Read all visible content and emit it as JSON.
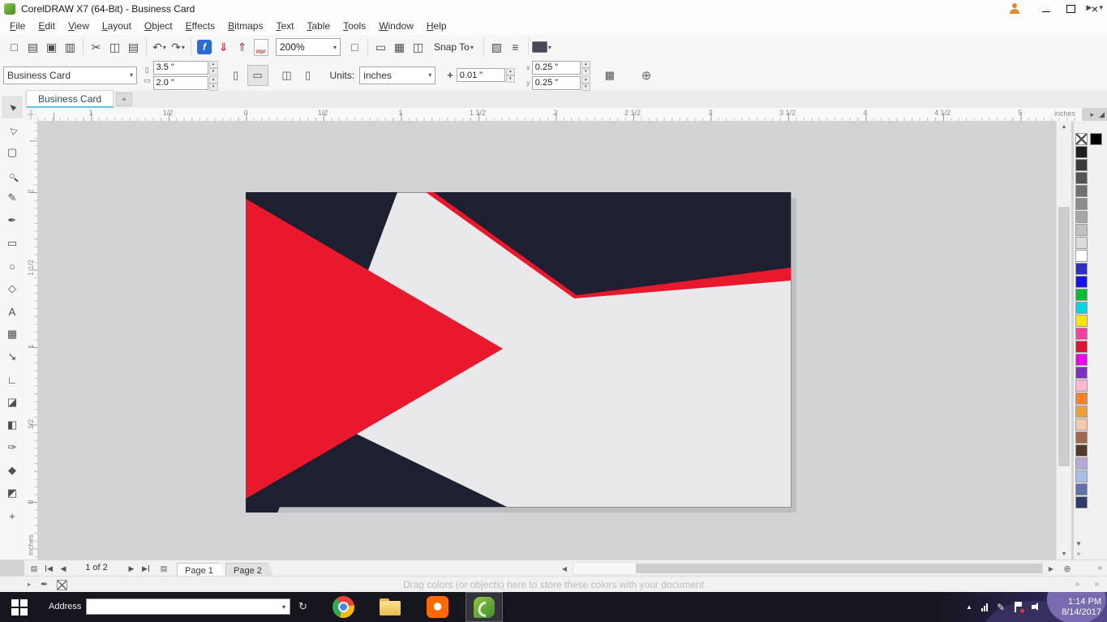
{
  "titlebar": {
    "title": "CorelDRAW X7 (64-Bit) - Business Card"
  },
  "menu": {
    "items": [
      "File",
      "Edit",
      "View",
      "Layout",
      "Object",
      "Effects",
      "Bitmaps",
      "Text",
      "Table",
      "Tools",
      "Window",
      "Help"
    ]
  },
  "toolbar": {
    "zoom_level": "200%",
    "snap_label": "Snap To",
    "pdf_label": "PDF",
    "f_label": "f"
  },
  "propbar": {
    "preset": "Business Card",
    "page_width": "3.5 \"",
    "page_height": "2.0 \"",
    "units_label": "Units:",
    "units": "inches",
    "nudge": "0.01 \"",
    "dup_x": "0.25 \"",
    "dup_y": "0.25 \""
  },
  "doctabs": {
    "active_tab": "Business Card",
    "add_tab": "+"
  },
  "rulers": {
    "h_labels": [
      "1",
      "1/2",
      "0",
      "1/2",
      "1",
      "1 1/2",
      "2",
      "2 1/2",
      "3",
      "3 1/2",
      "4",
      "4 1/2",
      "5"
    ],
    "v_labels": [
      "2",
      "1 1/2",
      "1",
      "1/2",
      "0"
    ],
    "h_unit": "inches",
    "v_unit": "inches"
  },
  "toolbox": [
    {
      "name": "Pick",
      "glyph": "▲"
    },
    {
      "name": "Shape",
      "glyph": "△"
    },
    {
      "name": "Crop",
      "glyph": "▢"
    },
    {
      "name": "Zoom",
      "glyph": "○"
    },
    {
      "name": "Freehand",
      "glyph": "✎"
    },
    {
      "name": "Artistic Media",
      "glyph": "✒"
    },
    {
      "name": "Rectangle",
      "glyph": "▭"
    },
    {
      "name": "Ellipse",
      "glyph": "○"
    },
    {
      "name": "Polygon",
      "glyph": "◇"
    },
    {
      "name": "Text",
      "glyph": "A"
    },
    {
      "name": "Table",
      "glyph": "▦"
    },
    {
      "name": "Parallel Dimension",
      "glyph": "↘"
    },
    {
      "name": "Connector",
      "glyph": "∟"
    },
    {
      "name": "Drop Shadow",
      "glyph": "◪"
    },
    {
      "name": "Transparency",
      "glyph": "◧"
    },
    {
      "name": "Color Eyedropper",
      "glyph": "✑"
    },
    {
      "name": "Interactive Fill",
      "glyph": "◆"
    },
    {
      "name": "Smart Fill",
      "glyph": "◩"
    },
    {
      "name": "Add Tools",
      "glyph": "+"
    }
  ],
  "canvas": {
    "card": {
      "bg": "#e9e9eb",
      "dark": "#1c2030",
      "red": "#e8192c",
      "shadow": "#bdbec0"
    }
  },
  "palette": {
    "black": "#000000",
    "colors": [
      "#1f1f1f",
      "#3a3a3a",
      "#555555",
      "#707070",
      "#8b8b8b",
      "#a6a6a6",
      "#c1c1c1",
      "#dcdcdc",
      "#ffffff",
      "#2e2ec8",
      "#1414f0",
      "#00c030",
      "#00d8e8",
      "#ffe400",
      "#ff3ca0",
      "#e81030",
      "#f000f0",
      "#8030c0",
      "#ffb8d0",
      "#ff8020",
      "#f0a030",
      "#f8c8a8",
      "#a06848",
      "#583828",
      "#b8a8d8",
      "#a8c0e8",
      "#6070a8",
      "#303c68"
    ]
  },
  "pagenav": {
    "counter": "1 of 2",
    "tabs": [
      "Page 1",
      "Page 2"
    ]
  },
  "status": {
    "hint": "Drag colors (or objects) here to store these colors with your document"
  },
  "taskbar": {
    "address_label": "Address",
    "clock_time": "1:14 PM",
    "clock_date": "8/14/2017"
  },
  "icons": {
    "new": "□",
    "open": "▤",
    "save": "▣",
    "print": "▥",
    "cut": "✂",
    "copy": "◫",
    "paste": "▤",
    "undo": "↶",
    "redo": "↷",
    "caret": "▾",
    "import": "⇓",
    "export": "⇑",
    "fullscreen": "□",
    "rulers_toggle": "▭",
    "grid": "▦",
    "guidelines": "◫",
    "options": "▧",
    "list": "≡",
    "portrait": "▯",
    "landscape": "▭",
    "all_pages": "◫",
    "current_page": "▯",
    "nudge": "+",
    "dup_x": "x",
    "dup_y": "y",
    "treat_filled": "▩",
    "add_frame": "⊕",
    "origin": "┼",
    "resize_grip": "◢",
    "tab_scroll": "▶",
    "page": "▤",
    "add_page": "▤",
    "nav_first": "◀",
    "nav_prev": "◀",
    "nav_next": "▶",
    "nav_last": "▶",
    "scroll_left": "◀",
    "scroll_right": "▶",
    "scroll_up": "▲",
    "scroll_down": "▼",
    "palette_down": "▼",
    "chevrons": "»",
    "zoom_in": "⊕",
    "status_pen": "✒",
    "refresh": "↻",
    "tray_up": "▲",
    "tray_pen": "✎",
    "small_right": "▸"
  }
}
